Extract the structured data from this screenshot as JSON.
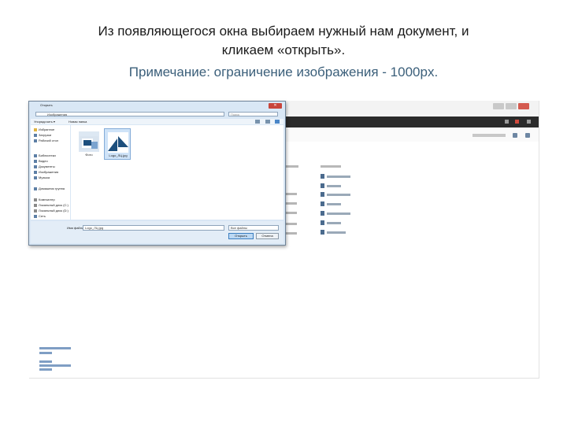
{
  "slide": {
    "caption_line1": "Из появляющегося окна выбираем нужный нам документ, и",
    "caption_line2": "кликаем «открыть».",
    "caption_line3": "Примечание: ограничение изображения - 1000px."
  },
  "dialog": {
    "title": "Открыть",
    "close_glyph": "✕",
    "address": "Изображения",
    "search_placeholder": "Поиск",
    "toolbar": {
      "organize_label": "Упорядочить ▾",
      "new_folder_label": "Новая папка"
    },
    "nav": {
      "favorites": "Избранное",
      "downloads": "Загрузки",
      "desktop": "Рабочий стол",
      "libraries": "Библиотеки",
      "video": "Видео",
      "documents": "Документы",
      "images": "Изображения",
      "music": "Музыка",
      "homegroup": "Домашняя группа",
      "computer": "Компьютер",
      "local_disk_c": "Локальный диск (C:)",
      "local_disk_d": "Локальный диск (D:)",
      "network": "Сеть"
    },
    "files": [
      {
        "name": "Фото"
      },
      {
        "name": "Logo_ЛЦ.jpg"
      }
    ],
    "filename_label": "Имя файла:",
    "filename_value": "Logo_ЛЦ.jpg",
    "filetype_value": "Все файлы",
    "open_label": "Открыть",
    "cancel_label": "Отмена"
  },
  "colors": {
    "brand_navy": "#1d4f7d",
    "dialog_bg": "#d9e7f5",
    "note_text": "#3b5f7a"
  }
}
